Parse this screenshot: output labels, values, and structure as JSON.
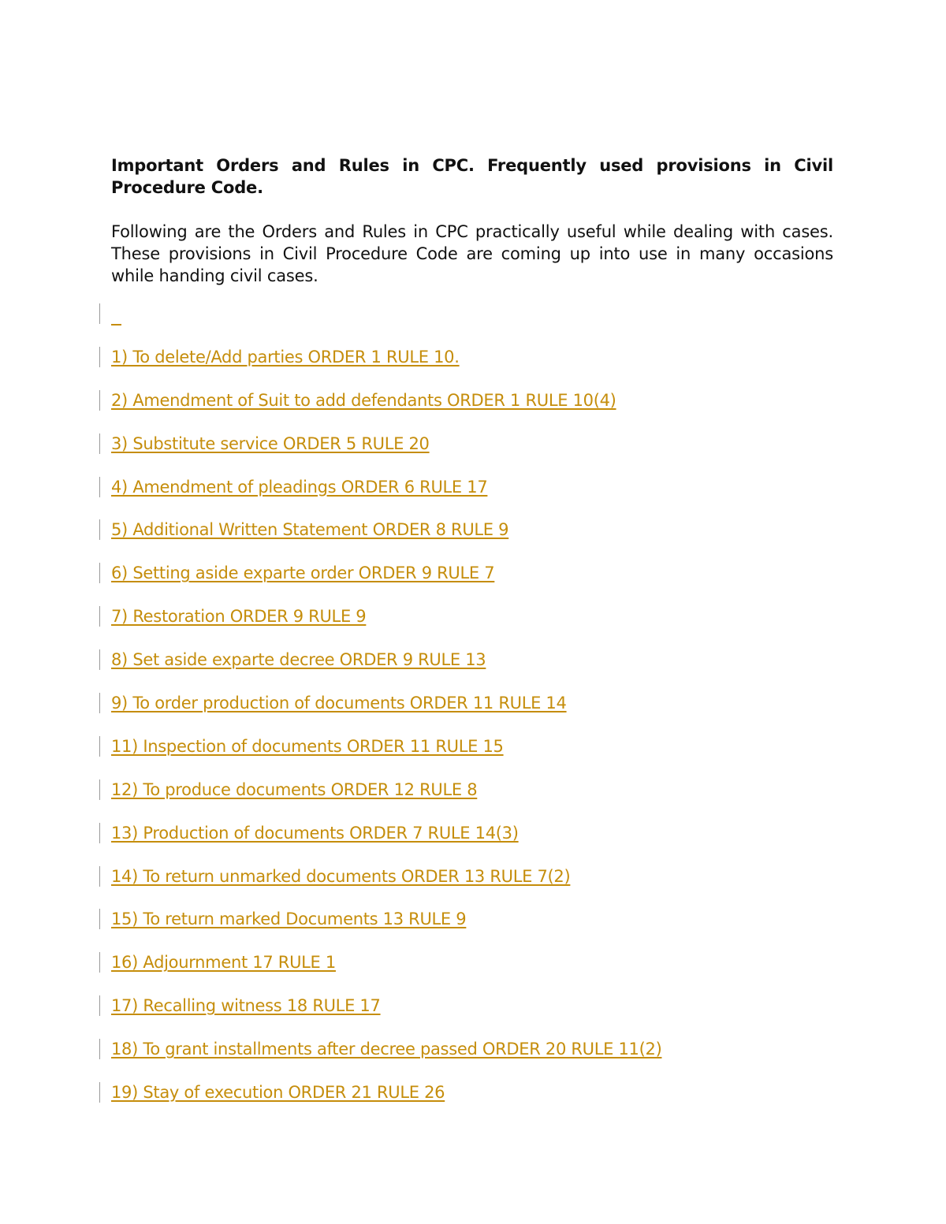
{
  "document": {
    "title": "Important Orders and Rules in CPC. Frequently used provisions in Civil Procedure Code.",
    "intro": "Following are the Orders and Rules in CPC practically useful while dealing with cases. These provisions in Civil Procedure Code are coming up into use in many occasions while handing civil cases.",
    "link_color": "#c58d0b",
    "items": [
      {
        "label": "1) To delete/Add parties ORDER 1 RULE 10."
      },
      {
        "label": "2) Amendment of Suit to add defendants ORDER 1 RULE 10(4)"
      },
      {
        "label": "3) Substitute service ORDER 5 RULE 20"
      },
      {
        "label": "4) Amendment of pleadings ORDER 6 RULE 17"
      },
      {
        "label": "5) Additional Written Statement ORDER 8 RULE 9"
      },
      {
        "label": "6) Setting aside exparte order ORDER 9 RULE 7"
      },
      {
        "label": "7) Restoration ORDER 9 RULE 9"
      },
      {
        "label": "8) Set aside exparte decree ORDER 9 RULE 13"
      },
      {
        "label": "9) To order production of documents ORDER 11 RULE 14"
      },
      {
        "label": "11) Inspection of documents ORDER 11 RULE 15"
      },
      {
        "label": "12) To produce documents ORDER 12 RULE 8"
      },
      {
        "label": "13) Production of documents ORDER 7 RULE 14(3)"
      },
      {
        "label": "14) To return unmarked documents ORDER 13 RULE 7(2)"
      },
      {
        "label": "15) To return marked Documents 13 RULE 9"
      },
      {
        "label": "16) Adjournment 17 RULE 1"
      },
      {
        "label": "17) Recalling witness 18 RULE 17"
      },
      {
        "label": "18) To grant installments after decree passed ORDER 20 RULE 11(2)"
      },
      {
        "label": "19) Stay of execution ORDER 21 RULE 26"
      }
    ]
  }
}
